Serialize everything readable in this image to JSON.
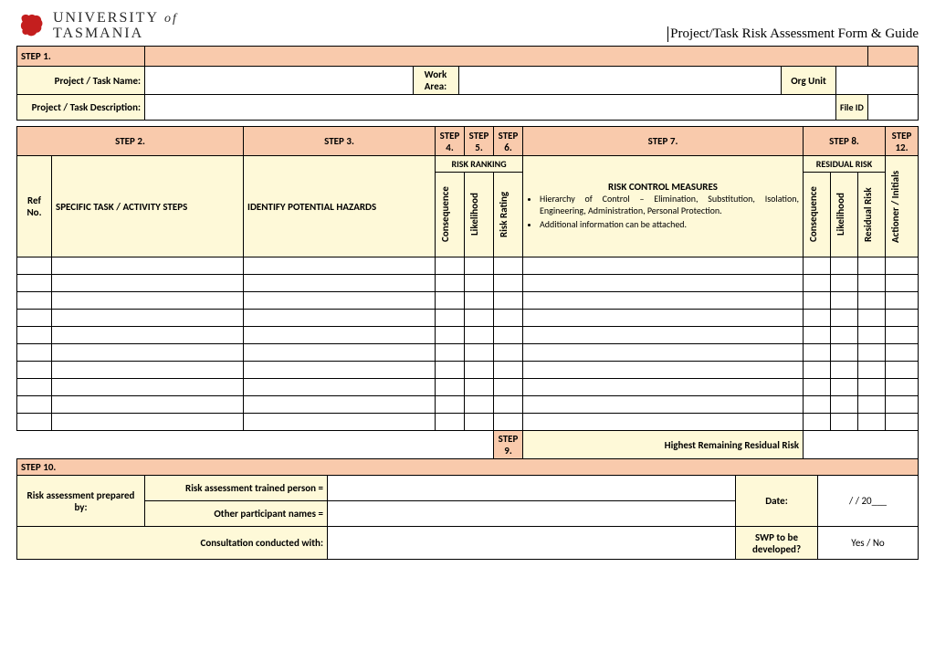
{
  "header": {
    "university_line1": "UNIVERSITY",
    "university_of": "of",
    "university_line2": "TASMANIA",
    "title": "Project/Task Risk Assessment Form & Guide"
  },
  "step1": {
    "label": "STEP 1.",
    "project_name_label": "Project / Task Name:",
    "work_area_label": "Work Area:",
    "org_unit_label": "Org Unit",
    "project_desc_label": "Project / Task Description:",
    "file_id_label": "File ID"
  },
  "steps_header": {
    "s2": "STEP 2.",
    "s3": "STEP 3.",
    "s4": "STEP 4.",
    "s5": "STEP 5.",
    "s6": "STEP 6.",
    "s7": "STEP 7.",
    "s8": "STEP 8.",
    "s12": "STEP 12."
  },
  "columns": {
    "ref_no": "Ref No.",
    "specific_task": "SPECIFIC TASK / ACTIVITY STEPS",
    "identify_hazards": "IDENTIFY POTENTIAL HAZARDS",
    "risk_ranking": "RISK RANKING",
    "consequence": "Consequence",
    "likelihood": "Likelihood",
    "risk_rating": "Risk Rating",
    "risk_control_title": "RISK CONTROL MEASURES",
    "hoc_bullet1": "Hierarchy of Control – Elimination, Substitution, Isolation, Engineering, Administration, Personal Protection.",
    "hoc_bullet2": "Additional information can be attached.",
    "residual_risk": "RESIDUAL RISK",
    "residual_consequence": "Consequence",
    "residual_likelihood": "Likelihood",
    "residual_rating": "Residual Risk",
    "actioner": "Actioner / Initials"
  },
  "step9": {
    "label": "STEP 9.",
    "text": "Highest Remaining Residual Risk"
  },
  "step10": {
    "label": "STEP 10.",
    "prepared_by": "Risk assessment prepared by:",
    "trained_person": "Risk assessment trained person =",
    "other_names": "Other participant names =",
    "date_label": "Date:",
    "date_value": "/       / 20___",
    "consultation": "Consultation conducted with:",
    "swp_label": "SWP to be developed?",
    "swp_value": "Yes    /    No"
  }
}
